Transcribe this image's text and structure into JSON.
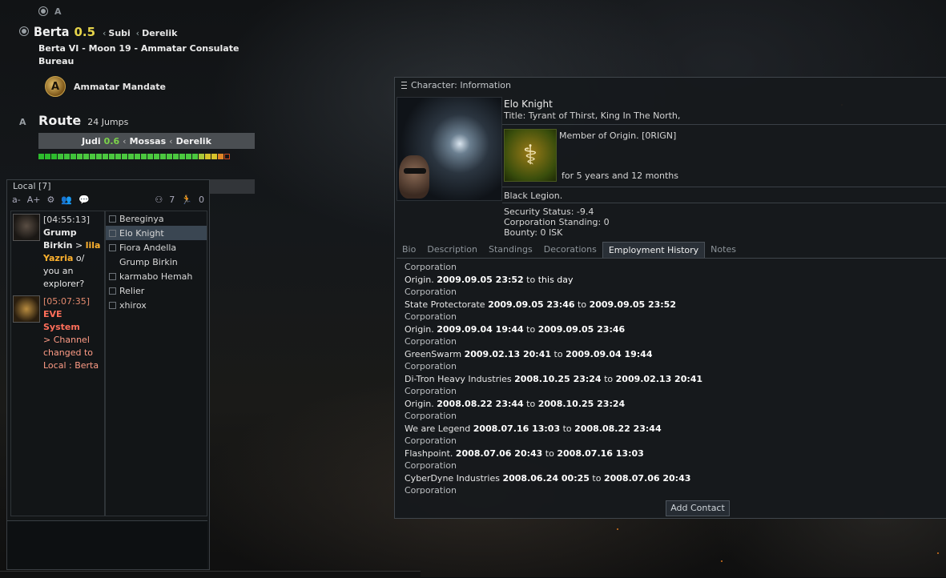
{
  "location": {
    "system": "Berta",
    "security": "0.5",
    "constellation": "Subi",
    "region": "Derelik",
    "station": "Berta VI - Moon 19 - Ammatar Consulate Bureau",
    "faction": "Ammatar Mandate",
    "icons": [
      "sun-icon",
      "autopilot-icon"
    ]
  },
  "route": {
    "title": "Route",
    "jumps": "24 Jumps",
    "next_system": "Judi",
    "next_security": "0.6",
    "via": "Mossas",
    "region": "Derelik",
    "pip_colors": [
      "#2dbb2d",
      "#2dbb2d",
      "#2dbb2d",
      "#3fc23a",
      "#3fc23a",
      "#3fc23a",
      "#4bc83f",
      "#4bc83f",
      "#4bc83f",
      "#4bc83f",
      "#4bc83f",
      "#4bc83f",
      "#4bc83f",
      "#4bc83f",
      "#4bc83f",
      "#4bc83f",
      "#4bc83f",
      "#4bc83f",
      "#4bc83f",
      "#4bc83f",
      "#4bc83f",
      "#4bc83f",
      "#4bc83f",
      "#4bc83f",
      "#4bc83f",
      "#aac83a",
      "#d7c32b",
      "#d7c32b",
      "#e08526",
      "#cc4a1a"
    ]
  },
  "local": {
    "title": "Local [7]",
    "font_smaller": "a-",
    "font_larger": "A+",
    "count_a": "7",
    "count_b": "0",
    "messages": [
      {
        "time": "[04:55:13]",
        "sender": "Grump Birkin",
        "arrow": ">",
        "highlight": "lila Yazria",
        "text": "o/ you an explorer?"
      },
      {
        "time": "[05:07:35]",
        "sender": "EVE System",
        "text": "> Channel changed to Local : Berta"
      }
    ],
    "members": [
      "Bereginya",
      "Elo Knight",
      "Fiora Andella",
      "Grump Birkin",
      "karmabo Hemah",
      "Relier",
      "xhirox"
    ]
  },
  "character": {
    "window_title": "Character: Information",
    "name": "Elo Knight",
    "title": "Title: Tyrant of Thirst, King In The North,",
    "member_of": "Member of Origin. [0RIGN]",
    "duration": "for 5 years and 12 months",
    "alliance": "Black Legion.",
    "security_status": "Security Status: -9.4",
    "corp_standing": "Corporation Standing: 0",
    "bounty": "Bounty: 0 ISK",
    "tabs": [
      "Bio",
      "Description",
      "Standings",
      "Decorations",
      "Employment History",
      "Notes"
    ],
    "active_tab": "Employment History",
    "history_label": "Corporation",
    "history": [
      {
        "corp": "Origin.",
        "from": "2009.09.05 23:52",
        "sep": "to",
        "to": "this day"
      },
      {
        "corp": "State Protectorate",
        "from": "2009.09.05 23:46",
        "sep": "to",
        "to": "2009.09.05 23:52"
      },
      {
        "corp": "Origin.",
        "from": "2009.09.04 19:44",
        "sep": "to",
        "to": "2009.09.05 23:46"
      },
      {
        "corp": "GreenSwarm",
        "from": "2009.02.13 20:41",
        "sep": "to",
        "to": "2009.09.04 19:44"
      },
      {
        "corp": "Di-Tron Heavy Industries",
        "from": "2008.10.25 23:24",
        "sep": "to",
        "to": "2009.02.13 20:41"
      },
      {
        "corp": "Origin.",
        "from": "2008.08.22 23:44",
        "sep": "to",
        "to": "2008.10.25 23:24"
      },
      {
        "corp": "We are Legend",
        "from": "2008.07.16 13:03",
        "sep": "to",
        "to": "2008.08.22 23:44"
      },
      {
        "corp": "Flashpoint.",
        "from": "2008.07.06 20:43",
        "sep": "to",
        "to": "2008.07.16 13:03"
      },
      {
        "corp": "CyberDyne Industries",
        "from": "2008.06.24 00:25",
        "sep": "to",
        "to": "2008.07.06 20:43"
      }
    ],
    "add_contact": "Add Contact"
  }
}
